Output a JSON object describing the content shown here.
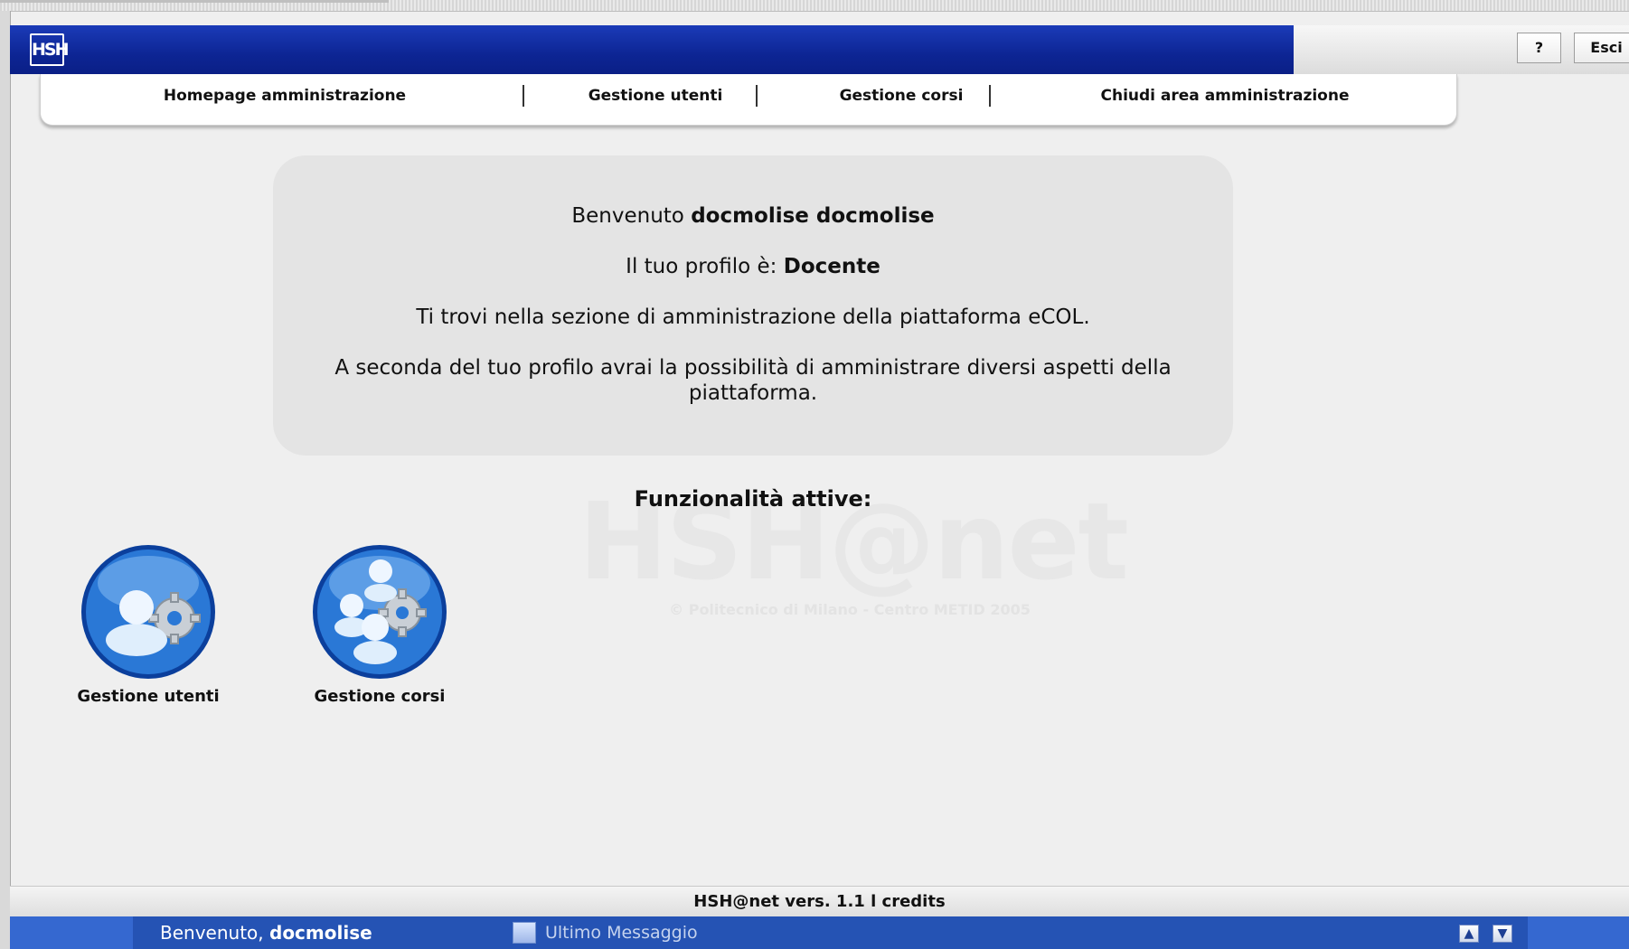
{
  "header": {
    "logo_text": "HSH",
    "help_button": "?",
    "exit_button": "Esci"
  },
  "nav": {
    "items": [
      {
        "label": "Homepage amministrazione"
      },
      {
        "label": "Gestione utenti"
      },
      {
        "label": "Gestione corsi"
      },
      {
        "label": "Chiudi area amministrazione"
      }
    ]
  },
  "welcome": {
    "greeting_prefix": "Benvenuto ",
    "user_full_name": "docmolise docmolise",
    "profile_prefix": "Il tuo profilo è: ",
    "profile_role": "Docente",
    "section_text": "Ti trovi nella sezione di amministrazione della piattaforma eCOL.",
    "description_line1": "A seconda del tuo profilo avrai la possibilità di amministrare diversi aspetti della",
    "description_line2": "piattaforma."
  },
  "functions": {
    "title": "Funzionalità attive:",
    "items": [
      {
        "label": "Gestione utenti",
        "icon": "user-gear-icon"
      },
      {
        "label": "Gestione corsi",
        "icon": "group-gear-icon"
      }
    ]
  },
  "watermark": {
    "text": "HSH@net",
    "subtext": "© Politecnico di Milano - Centro METID 2005"
  },
  "footer": {
    "version": "HSH@net vers. 1.1",
    "separator": "l",
    "credits": "credits"
  },
  "statusbar": {
    "welcome_prefix": "Benvenuto, ",
    "username": "docmolise",
    "last_message_label": "Ultimo Messaggio",
    "up_arrow": "▲",
    "down_arrow": "▼"
  },
  "colors": {
    "header_blue": "#0d2594",
    "statusbar_blue": "#2553b4",
    "icon_blue": "#1e64c8"
  }
}
